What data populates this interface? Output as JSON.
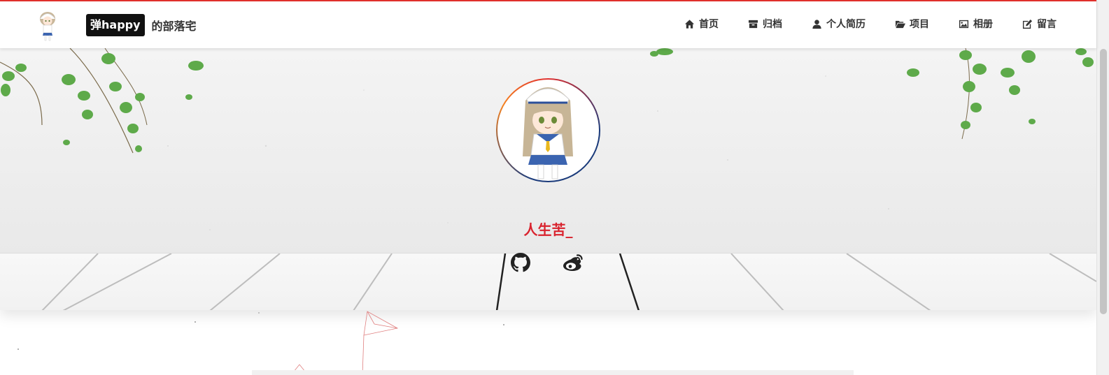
{
  "brand": {
    "highlight": "弹happy",
    "suffix": "的部落宅"
  },
  "nav": [
    {
      "label": "首页",
      "icon": "home-icon"
    },
    {
      "label": "归档",
      "icon": "archive-icon"
    },
    {
      "label": "个人简历",
      "icon": "user-icon"
    },
    {
      "label": "项目",
      "icon": "folder-open-icon"
    },
    {
      "label": "相册",
      "icon": "image-icon"
    },
    {
      "label": "留言",
      "icon": "edit-icon"
    }
  ],
  "hero": {
    "username": "人生苦_"
  },
  "social": [
    {
      "icon": "github-icon"
    },
    {
      "icon": "weibo-icon"
    }
  ],
  "colors": {
    "accent": "#d9232e",
    "border_top": "#e0302b",
    "nav_text": "#333333",
    "brand_bg": "#111111"
  }
}
